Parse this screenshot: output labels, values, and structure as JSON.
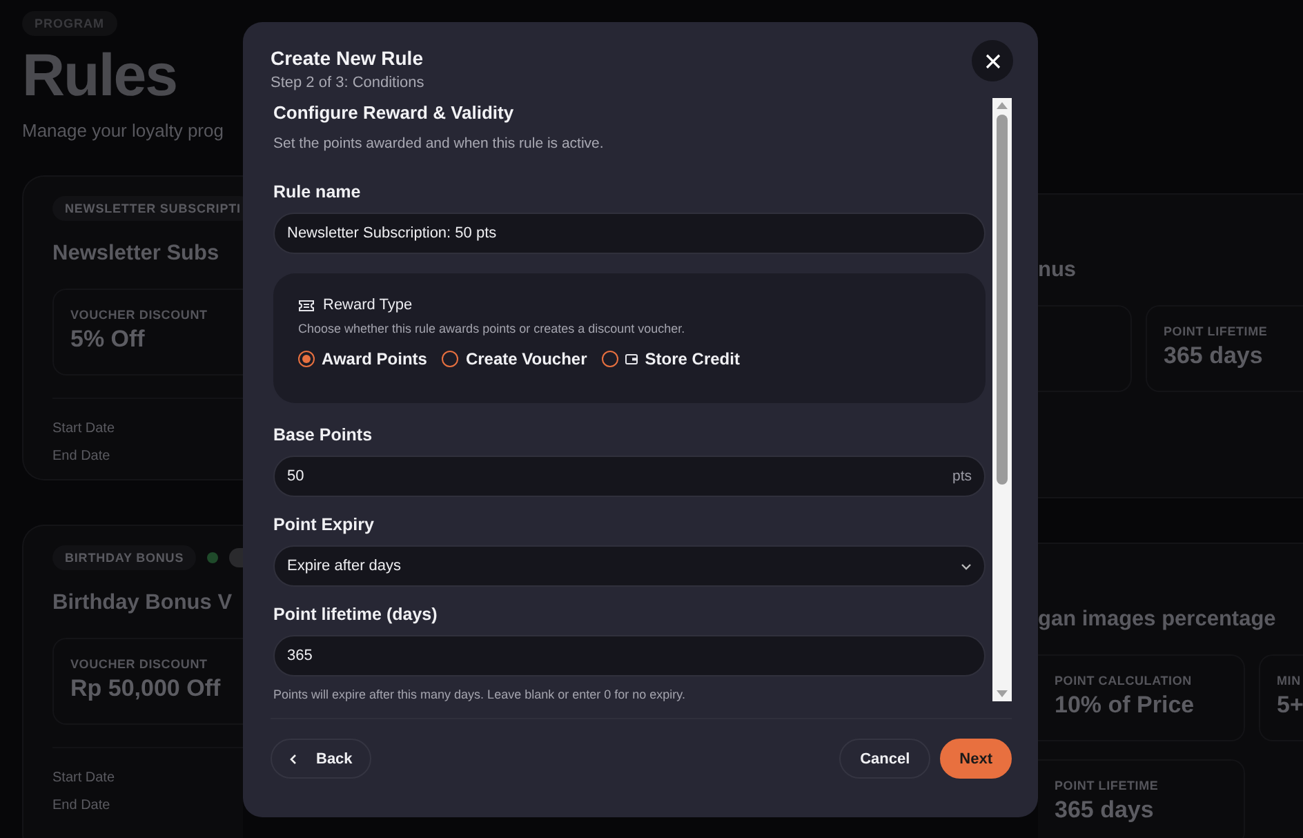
{
  "background": {
    "eyebrow": "PROGRAM",
    "title": "Rules",
    "subtitle": "Manage your loyalty prog",
    "cards": [
      {
        "tag": "NEWSLETTER SUBSCRIPTI",
        "title_start": "Newsletter Subs",
        "title_end": "nus",
        "left_stats": [
          {
            "label": "VOUCHER DISCOUNT",
            "value": "5% Off"
          }
        ],
        "edge_box": true,
        "right_stats": [
          [
            {
              "label": "POINT LIFETIME",
              "value": "365 days"
            }
          ]
        ],
        "dates": [
          "Start Date",
          "End Date"
        ]
      },
      {
        "tag": "BIRTHDAY BONUS",
        "status_dot": true,
        "title_start": "Birthday Bonus V",
        "title_end": "gan images percentage",
        "left_stats": [
          {
            "label": "VOUCHER DISCOUNT",
            "value": "Rp 50,000 Off"
          }
        ],
        "right_stats": [
          [
            {
              "label": "POINT CALCULATION",
              "value": "10% of Price"
            },
            {
              "label": "MIN",
              "value": "5+"
            }
          ],
          [
            {
              "label": "POINT LIFETIME",
              "value": "365 days"
            }
          ]
        ],
        "dates": [
          "Start Date",
          "End Date"
        ]
      }
    ]
  },
  "dialog": {
    "title": "Create New Rule",
    "step": "Step 2 of 3: Conditions",
    "section_title": "Configure Reward & Validity",
    "section_description": "Set the points awarded and when this rule is active.",
    "rule_name": {
      "label": "Rule name",
      "value": "Newsletter Subscription: 50 pts"
    },
    "reward_type": {
      "title": "Reward Type",
      "description": "Choose whether this rule awards points or creates a discount voucher.",
      "options": [
        {
          "label": "Award Points",
          "selected": true
        },
        {
          "label": "Create Voucher",
          "selected": false
        },
        {
          "label": "Store Credit",
          "selected": false,
          "icon": true
        }
      ]
    },
    "base_points": {
      "label": "Base Points",
      "value": "50",
      "suffix": "pts"
    },
    "point_expiry": {
      "label": "Point Expiry",
      "value": "Expire after days"
    },
    "point_lifetime": {
      "label": "Point lifetime (days)",
      "value": "365",
      "help": "Points will expire after this many days. Leave blank or enter 0 for no expiry."
    },
    "buttons": {
      "back": "Back",
      "cancel": "Cancel",
      "next": "Next"
    }
  }
}
